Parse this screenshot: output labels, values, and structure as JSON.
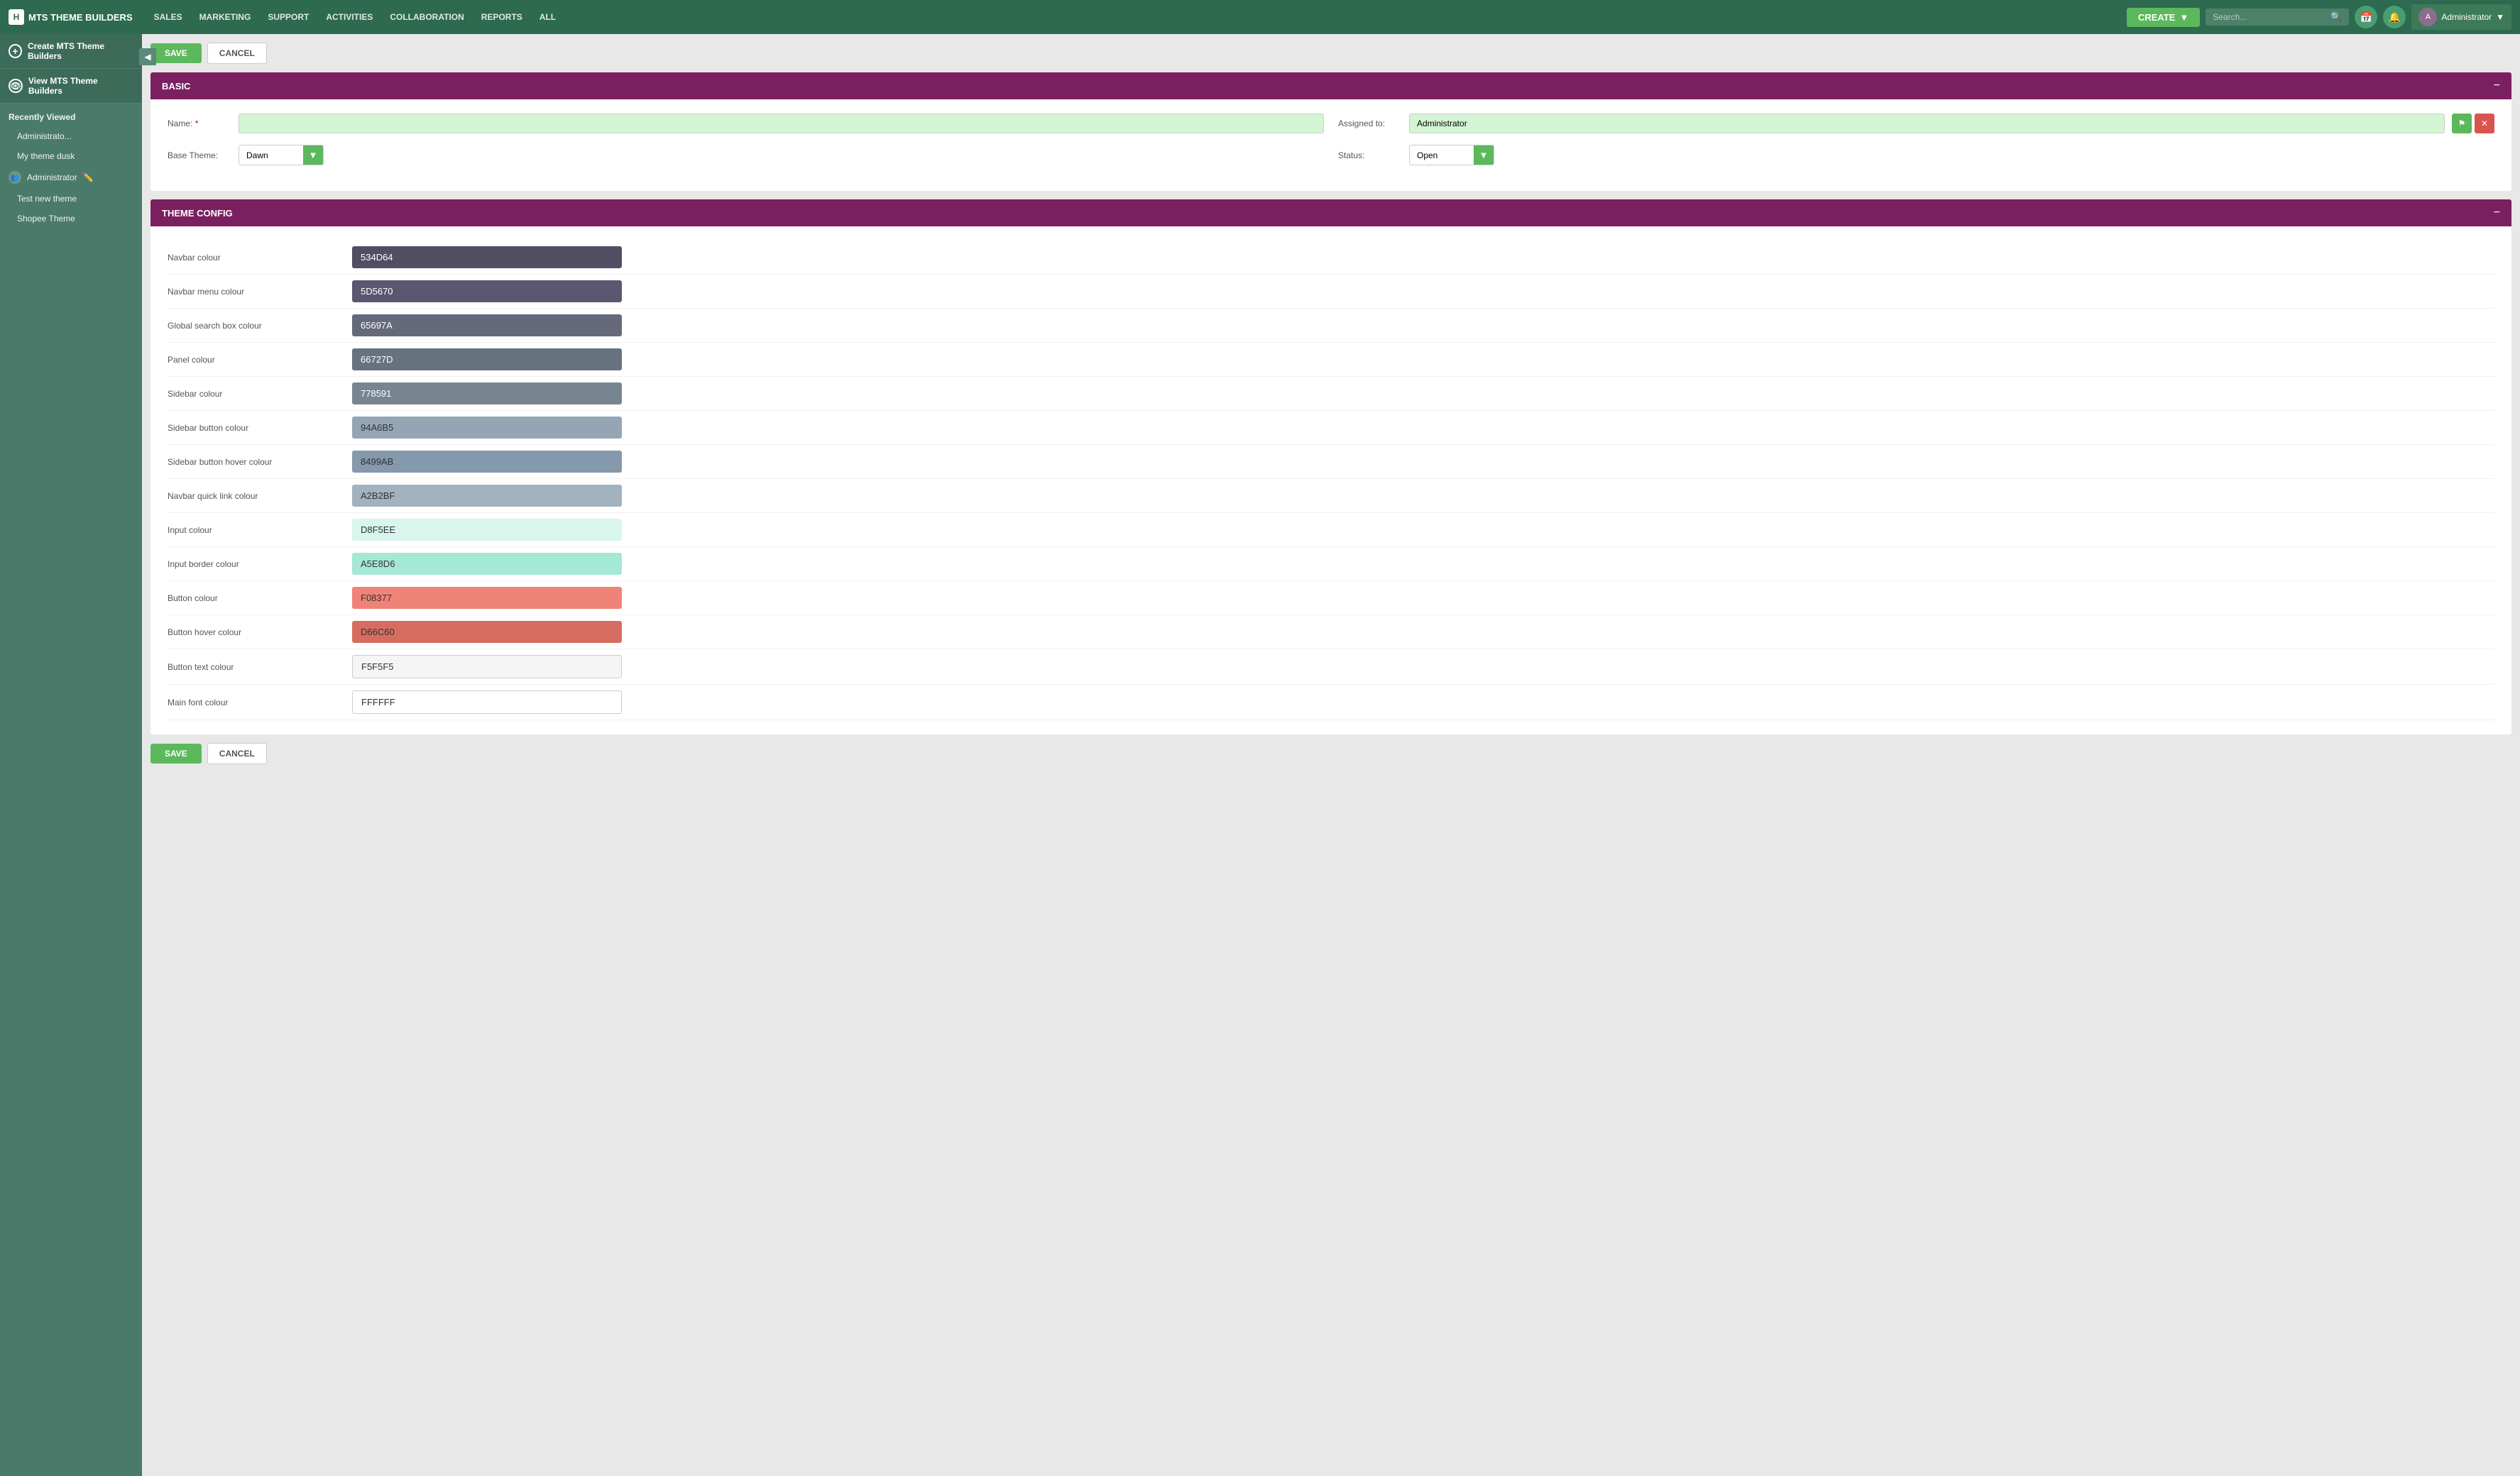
{
  "app": {
    "brand": "MTS THEME BUILDERS",
    "brand_icon": "H"
  },
  "topnav": {
    "links": [
      "SALES",
      "MARKETING",
      "SUPPORT",
      "ACTIVITIES",
      "COLLABORATION",
      "REPORTS",
      "ALL"
    ],
    "create_label": "CREATE",
    "search_placeholder": "Search...",
    "user_label": "Administrator"
  },
  "sidebar": {
    "create_label": "Create MTS Theme Builders",
    "view_label": "View MTS Theme Builders",
    "recently_viewed_label": "Recently Viewed",
    "items": [
      {
        "label": "Administrato..."
      },
      {
        "label": "My theme dusk"
      }
    ],
    "group_label": "Administrator",
    "group_items": [
      {
        "label": "Test new theme"
      },
      {
        "label": "Shopee Theme"
      }
    ]
  },
  "toolbar_top": {
    "save_label": "SAVE",
    "cancel_label": "CANCEL"
  },
  "toolbar_bottom": {
    "save_label": "SAVE",
    "cancel_label": "CANCEL"
  },
  "basic_section": {
    "title": "BASIC",
    "name_label": "Name:",
    "name_value": "",
    "assigned_to_label": "Assigned to:",
    "assigned_to_value": "Administrator",
    "base_theme_label": "Base Theme:",
    "base_theme_value": "Dawn",
    "status_label": "Status:",
    "status_value": "Open"
  },
  "theme_config_section": {
    "title": "THEME CONFIG",
    "fields": [
      {
        "label": "Navbar colour",
        "value": "534D64",
        "bg": "#534D64",
        "text_color": "#ffffff"
      },
      {
        "label": "Navbar menu colour",
        "value": "5D5670",
        "bg": "#5D5670",
        "text_color": "#ffffff"
      },
      {
        "label": "Global search box colour",
        "value": "65697A",
        "bg": "#65697A",
        "text_color": "#ffffff"
      },
      {
        "label": "Panel colour",
        "value": "66727D",
        "bg": "#66727D",
        "text_color": "#ffffff"
      },
      {
        "label": "Sidebar colour",
        "value": "778591",
        "bg": "#778591",
        "text_color": "#ffffff"
      },
      {
        "label": "Sidebar button colour",
        "value": "94A6B5",
        "bg": "#94A6B5",
        "text_color": "#333333"
      },
      {
        "label": "Sidebar button hover colour",
        "value": "8499AB",
        "bg": "#8499AB",
        "text_color": "#333333"
      },
      {
        "label": "Navbar quick link colour",
        "value": "A2B2BF",
        "bg": "#A2B2BF",
        "text_color": "#333333"
      },
      {
        "label": "Input colour",
        "value": "D8F5EE",
        "bg": "#D8F5EE",
        "text_color": "#333333"
      },
      {
        "label": "Input border colour",
        "value": "A5E8D6",
        "bg": "#A5E8D6",
        "text_color": "#333333"
      },
      {
        "label": "Button colour",
        "value": "F08377",
        "bg": "#F08377",
        "text_color": "#333333"
      },
      {
        "label": "Button hover colour",
        "value": "D66C60",
        "bg": "#D66C60",
        "text_color": "#333333"
      },
      {
        "label": "Button text colour",
        "value": "F5F5F5",
        "bg": "#F5F5F5",
        "text_color": "#333333"
      },
      {
        "label": "Main font colour",
        "value": "FFFFFF",
        "bg": "#FFFFFF",
        "text_color": "#333333"
      }
    ]
  }
}
